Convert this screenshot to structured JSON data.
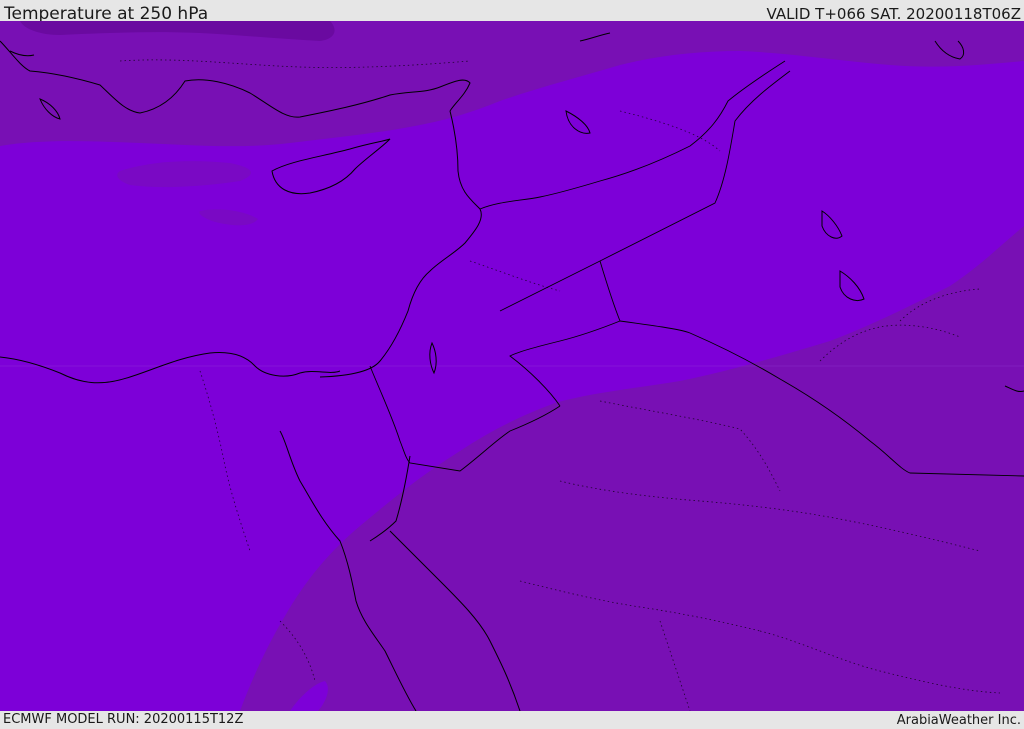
{
  "header": {
    "title": "Temperature at 250 hPa",
    "valid": "VALID T+066 SAT. 20200118T06Z"
  },
  "footer": {
    "model_run": "ECMWF MODEL RUN: 20200115T12Z",
    "credit": "ArabiaWeather Inc."
  },
  "colors": {
    "frame_background": "#e6e6e6",
    "field_warm": "#7810b4",
    "field_mid": "#7d00d8",
    "field_cold": "#6a0aa0",
    "coastline": "#000000"
  }
}
